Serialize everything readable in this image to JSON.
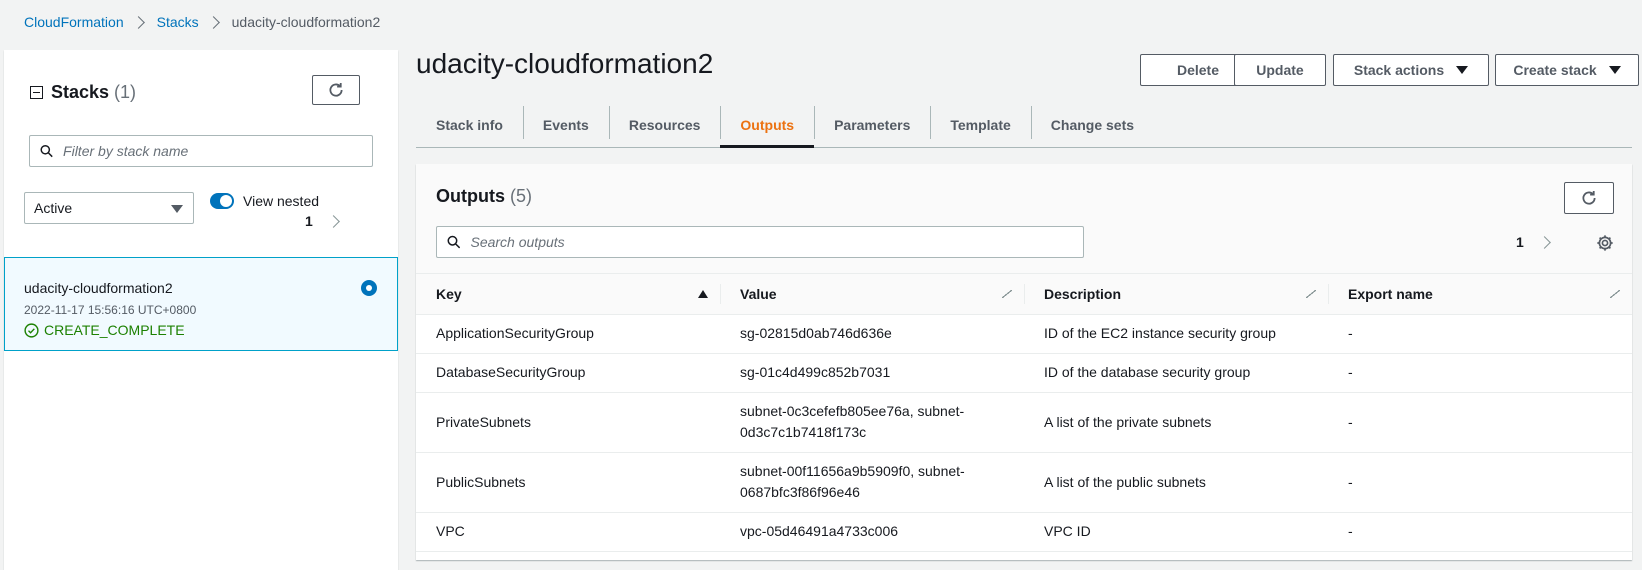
{
  "breadcrumb": {
    "items": [
      "CloudFormation",
      "Stacks"
    ],
    "current": "udacity-cloudformation2"
  },
  "stacks_panel": {
    "title": "Stacks",
    "count": "(1)",
    "filter_placeholder": "Filter by stack name",
    "status_filter": "Active",
    "view_nested_label": "View nested",
    "page": "1",
    "stack": {
      "name": "udacity-cloudformation2",
      "date": "2022-11-17 15:56:16 UTC+0800",
      "status": "CREATE_COMPLETE"
    }
  },
  "header": {
    "title": "udacity-cloudformation2",
    "buttons": {
      "delete": "Delete",
      "update": "Update",
      "stack_actions": "Stack actions",
      "create_stack": "Create stack"
    }
  },
  "tabs": [
    "Stack info",
    "Events",
    "Resources",
    "Outputs",
    "Parameters",
    "Template",
    "Change sets"
  ],
  "active_tab": "Outputs",
  "outputs": {
    "title": "Outputs",
    "count": "(5)",
    "search_placeholder": "Search outputs",
    "page": "1",
    "columns": [
      "Key",
      "Value",
      "Description",
      "Export name"
    ],
    "rows": [
      {
        "key": "ApplicationSecurityGroup",
        "value": "sg-02815d0ab746d636e",
        "description": "ID of the EC2 instance security group",
        "export": "-"
      },
      {
        "key": "DatabaseSecurityGroup",
        "value": "sg-01c4d499c852b7031",
        "description": "ID of the database security group",
        "export": "-"
      },
      {
        "key": "PrivateSubnets",
        "value": "subnet-0c3cefefb805ee76a, subnet-0d3c7c1b7418f173c",
        "description": "A list of the private subnets",
        "export": "-"
      },
      {
        "key": "PublicSubnets",
        "value": "subnet-00f11656a9b5909f0, subnet-0687bfc3f86f96e46",
        "description": "A list of the public subnets",
        "export": "-"
      },
      {
        "key": "VPC",
        "value": "vpc-05d46491a4733c006",
        "description": "VPC ID",
        "export": "-"
      }
    ]
  },
  "colors": {
    "link": "#0073bb",
    "active_tab": "#ec7211",
    "success": "#1d8102",
    "selected_bg": "#f1faff"
  }
}
